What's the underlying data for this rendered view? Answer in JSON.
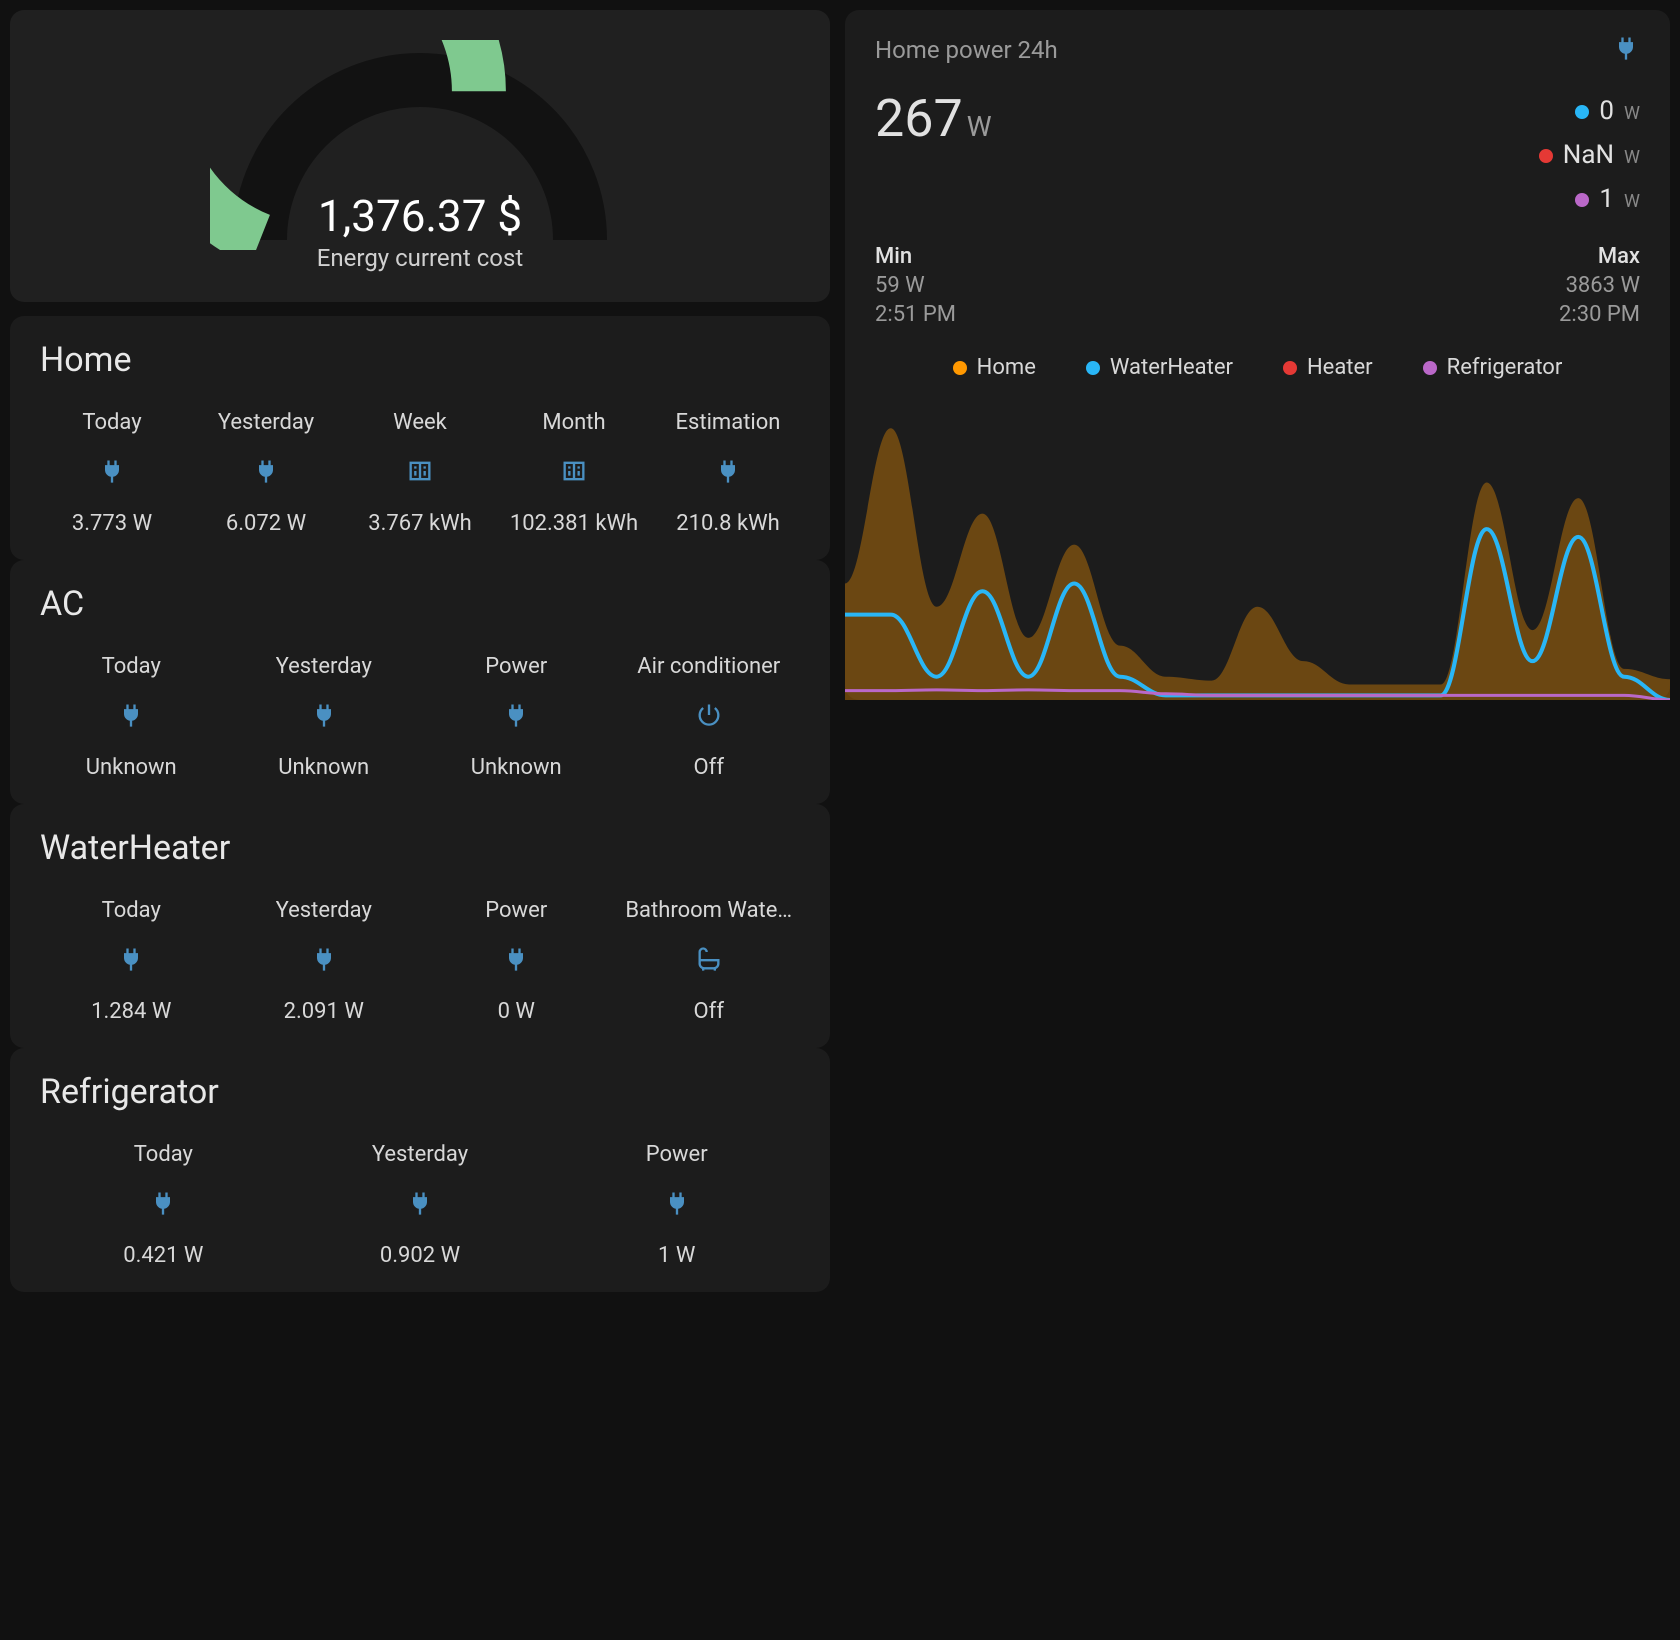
{
  "gauge": {
    "value": "1,376.37 $",
    "label": "Energy current cost",
    "fill_pct": 62
  },
  "sections": [
    {
      "title": "Home",
      "stats": [
        {
          "label": "Today",
          "icon": "plug",
          "value": "3.773 W"
        },
        {
          "label": "Yesterday",
          "icon": "plug",
          "value": "6.072 W"
        },
        {
          "label": "Week",
          "icon": "meter",
          "value": "3.767 kWh"
        },
        {
          "label": "Month",
          "icon": "meter",
          "value": "102.381 kWh"
        },
        {
          "label": "Estimation",
          "icon": "plug",
          "value": "210.8 kWh"
        }
      ]
    },
    {
      "title": "AC",
      "stats": [
        {
          "label": "Today",
          "icon": "plug",
          "value": "Unknown"
        },
        {
          "label": "Yesterday",
          "icon": "plug",
          "value": "Unknown"
        },
        {
          "label": "Power",
          "icon": "plug",
          "value": "Unknown"
        },
        {
          "label": "Air conditioner",
          "icon": "power",
          "value": "Off"
        }
      ]
    },
    {
      "title": "WaterHeater",
      "stats": [
        {
          "label": "Today",
          "icon": "plug",
          "value": "1.284 W"
        },
        {
          "label": "Yesterday",
          "icon": "plug",
          "value": "2.091 W"
        },
        {
          "label": "Power",
          "icon": "plug",
          "value": "0 W"
        },
        {
          "label": "Bathroom Wate…",
          "icon": "bath",
          "value": "Off"
        }
      ]
    },
    {
      "title": "Refrigerator",
      "stats": [
        {
          "label": "Today",
          "icon": "plug",
          "value": "0.421 W"
        },
        {
          "label": "Yesterday",
          "icon": "plug",
          "value": "0.902 W"
        },
        {
          "label": "Power",
          "icon": "plug",
          "value": "1 W"
        }
      ]
    }
  ],
  "power_card": {
    "title": "Home power 24h",
    "big_value": "267",
    "big_unit": "W",
    "right_legend": [
      {
        "color": "#29b6f6",
        "value": "0",
        "unit": "W"
      },
      {
        "color": "#e53935",
        "value": "NaN",
        "unit": "W"
      },
      {
        "color": "#ba68c8",
        "value": "1",
        "unit": "W"
      }
    ],
    "min": {
      "label": "Min",
      "value": "59 W",
      "time": "2:51 PM"
    },
    "max": {
      "label": "Max",
      "value": "3863 W",
      "time": "2:30 PM"
    },
    "chart_legend": [
      {
        "color": "#ff9800",
        "label": "Home"
      },
      {
        "color": "#29b6f6",
        "label": "WaterHeater"
      },
      {
        "color": "#e53935",
        "label": "Heater"
      },
      {
        "color": "#ba68c8",
        "label": "Refrigerator"
      }
    ]
  },
  "chart_data": {
    "type": "area",
    "title": "Home power 24h",
    "ylabel": "W",
    "ylim": [
      0,
      3863
    ],
    "x_range_hours": 24,
    "series": [
      {
        "name": "Home",
        "color": "#ff9800",
        "values": [
          1500,
          3500,
          1200,
          2400,
          800,
          2000,
          700,
          300,
          250,
          1200,
          500,
          200,
          200,
          200,
          2800,
          900,
          2600,
          400,
          267
        ]
      },
      {
        "name": "WaterHeater",
        "color": "#29b6f6",
        "values": [
          1100,
          1100,
          300,
          1400,
          300,
          1500,
          300,
          60,
          60,
          60,
          60,
          60,
          60,
          60,
          2200,
          500,
          2100,
          300,
          0
        ]
      },
      {
        "name": "Heater",
        "color": "#e53935",
        "values": [
          null,
          null,
          null,
          null,
          null,
          null,
          null,
          null,
          null,
          null,
          null,
          null,
          null,
          null,
          null,
          null,
          null,
          null,
          null
        ]
      },
      {
        "name": "Refrigerator",
        "color": "#ba68c8",
        "values": [
          120,
          120,
          130,
          120,
          130,
          120,
          120,
          80,
          60,
          60,
          60,
          60,
          60,
          60,
          60,
          60,
          60,
          60,
          1
        ]
      }
    ]
  },
  "colors": {
    "accent": "#4a90c2",
    "gauge_green": "#7fc98f",
    "gauge_dark": "#121212"
  }
}
